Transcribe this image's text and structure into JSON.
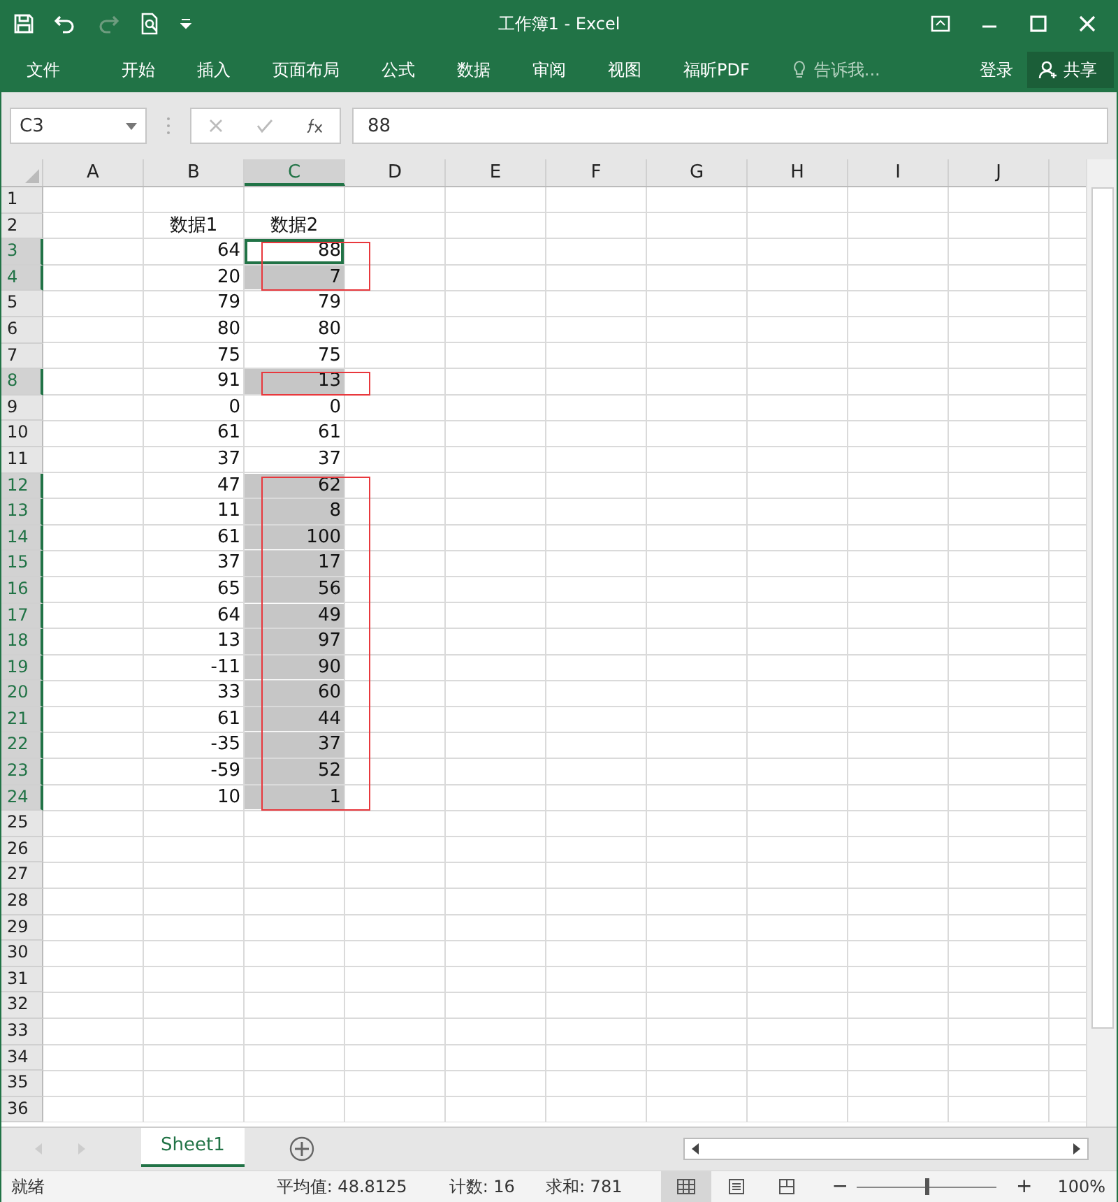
{
  "window": {
    "title": "工作簿1 - Excel"
  },
  "ribbon_tabs": [
    {
      "label": "文件"
    },
    {
      "label": "开始"
    },
    {
      "label": "插入"
    },
    {
      "label": "页面布局"
    },
    {
      "label": "公式"
    },
    {
      "label": "数据"
    },
    {
      "label": "审阅"
    },
    {
      "label": "视图"
    },
    {
      "label": "福昕PDF"
    }
  ],
  "tell_me": "告诉我...",
  "sign_in": "登录",
  "share": "共享",
  "name_box": "C3",
  "formula": "88",
  "columns": [
    {
      "label": "A",
      "selected": false
    },
    {
      "label": "B",
      "selected": false
    },
    {
      "label": "C",
      "selected": true
    },
    {
      "label": "D",
      "selected": false
    },
    {
      "label": "E",
      "selected": false
    },
    {
      "label": "F",
      "selected": false
    },
    {
      "label": "G",
      "selected": false
    },
    {
      "label": "H",
      "selected": false
    },
    {
      "label": "I",
      "selected": false
    },
    {
      "label": "J",
      "selected": false
    }
  ],
  "rows": [
    {
      "num": "1",
      "selected": false,
      "boxed": false
    },
    {
      "num": "2",
      "b": "数据1",
      "c": "数据2",
      "selected": false,
      "boxed": false
    },
    {
      "num": "3",
      "b": "64",
      "c": "88",
      "selected": true,
      "active": true,
      "boxed": true
    },
    {
      "num": "4",
      "b": "20",
      "c": "7",
      "selected": true,
      "boxed": true
    },
    {
      "num": "5",
      "b": "79",
      "c": "79",
      "selected": false,
      "boxed": false
    },
    {
      "num": "6",
      "b": "80",
      "c": "80",
      "selected": false,
      "boxed": false
    },
    {
      "num": "7",
      "b": "75",
      "c": "75",
      "selected": false,
      "boxed": false
    },
    {
      "num": "8",
      "b": "91",
      "c": "13",
      "selected": true,
      "boxed": true
    },
    {
      "num": "9",
      "b": "0",
      "c": "0",
      "selected": false,
      "boxed": false
    },
    {
      "num": "10",
      "b": "61",
      "c": "61",
      "selected": false,
      "boxed": false
    },
    {
      "num": "11",
      "b": "37",
      "c": "37",
      "selected": false,
      "boxed": false
    },
    {
      "num": "12",
      "b": "47",
      "c": "62",
      "selected": true,
      "boxed": true
    },
    {
      "num": "13",
      "b": "11",
      "c": "8",
      "selected": true,
      "boxed": true
    },
    {
      "num": "14",
      "b": "61",
      "c": "100",
      "selected": true,
      "boxed": true
    },
    {
      "num": "15",
      "b": "37",
      "c": "17",
      "selected": true,
      "boxed": true
    },
    {
      "num": "16",
      "b": "65",
      "c": "56",
      "selected": true,
      "boxed": true
    },
    {
      "num": "17",
      "b": "64",
      "c": "49",
      "selected": true,
      "boxed": true
    },
    {
      "num": "18",
      "b": "13",
      "c": "97",
      "selected": true,
      "boxed": true
    },
    {
      "num": "19",
      "b": "-11",
      "c": "90",
      "selected": true,
      "boxed": true
    },
    {
      "num": "20",
      "b": "33",
      "c": "60",
      "selected": true,
      "boxed": true
    },
    {
      "num": "21",
      "b": "61",
      "c": "44",
      "selected": true,
      "boxed": true
    },
    {
      "num": "22",
      "b": "-35",
      "c": "37",
      "selected": true,
      "boxed": true
    },
    {
      "num": "23",
      "b": "-59",
      "c": "52",
      "selected": true,
      "boxed": true
    },
    {
      "num": "24",
      "b": "10",
      "c": "1",
      "selected": true,
      "boxed": true
    },
    {
      "num": "25",
      "selected": false,
      "boxed": false
    },
    {
      "num": "26",
      "selected": false,
      "boxed": false
    },
    {
      "num": "27",
      "selected": false,
      "boxed": false
    },
    {
      "num": "28",
      "selected": false,
      "boxed": false
    },
    {
      "num": "29",
      "selected": false,
      "boxed": false
    },
    {
      "num": "30",
      "selected": false,
      "boxed": false
    },
    {
      "num": "31",
      "selected": false,
      "boxed": false
    },
    {
      "num": "32",
      "selected": false,
      "boxed": false
    },
    {
      "num": "33",
      "selected": false,
      "boxed": false
    },
    {
      "num": "34",
      "selected": false,
      "boxed": false
    },
    {
      "num": "35",
      "selected": false,
      "boxed": false
    },
    {
      "num": "36",
      "selected": false,
      "boxed": false
    }
  ],
  "sheet_tabs": [
    {
      "label": "Sheet1",
      "selected": true
    }
  ],
  "status_bar": {
    "ready": "就绪",
    "average": "平均值: 48.8125",
    "count": "计数: 16",
    "sum": "求和: 781",
    "zoom": "100%",
    "zoom_out": "−",
    "zoom_in": "+",
    "zoom_level": {
      "level": 0.5
    }
  }
}
